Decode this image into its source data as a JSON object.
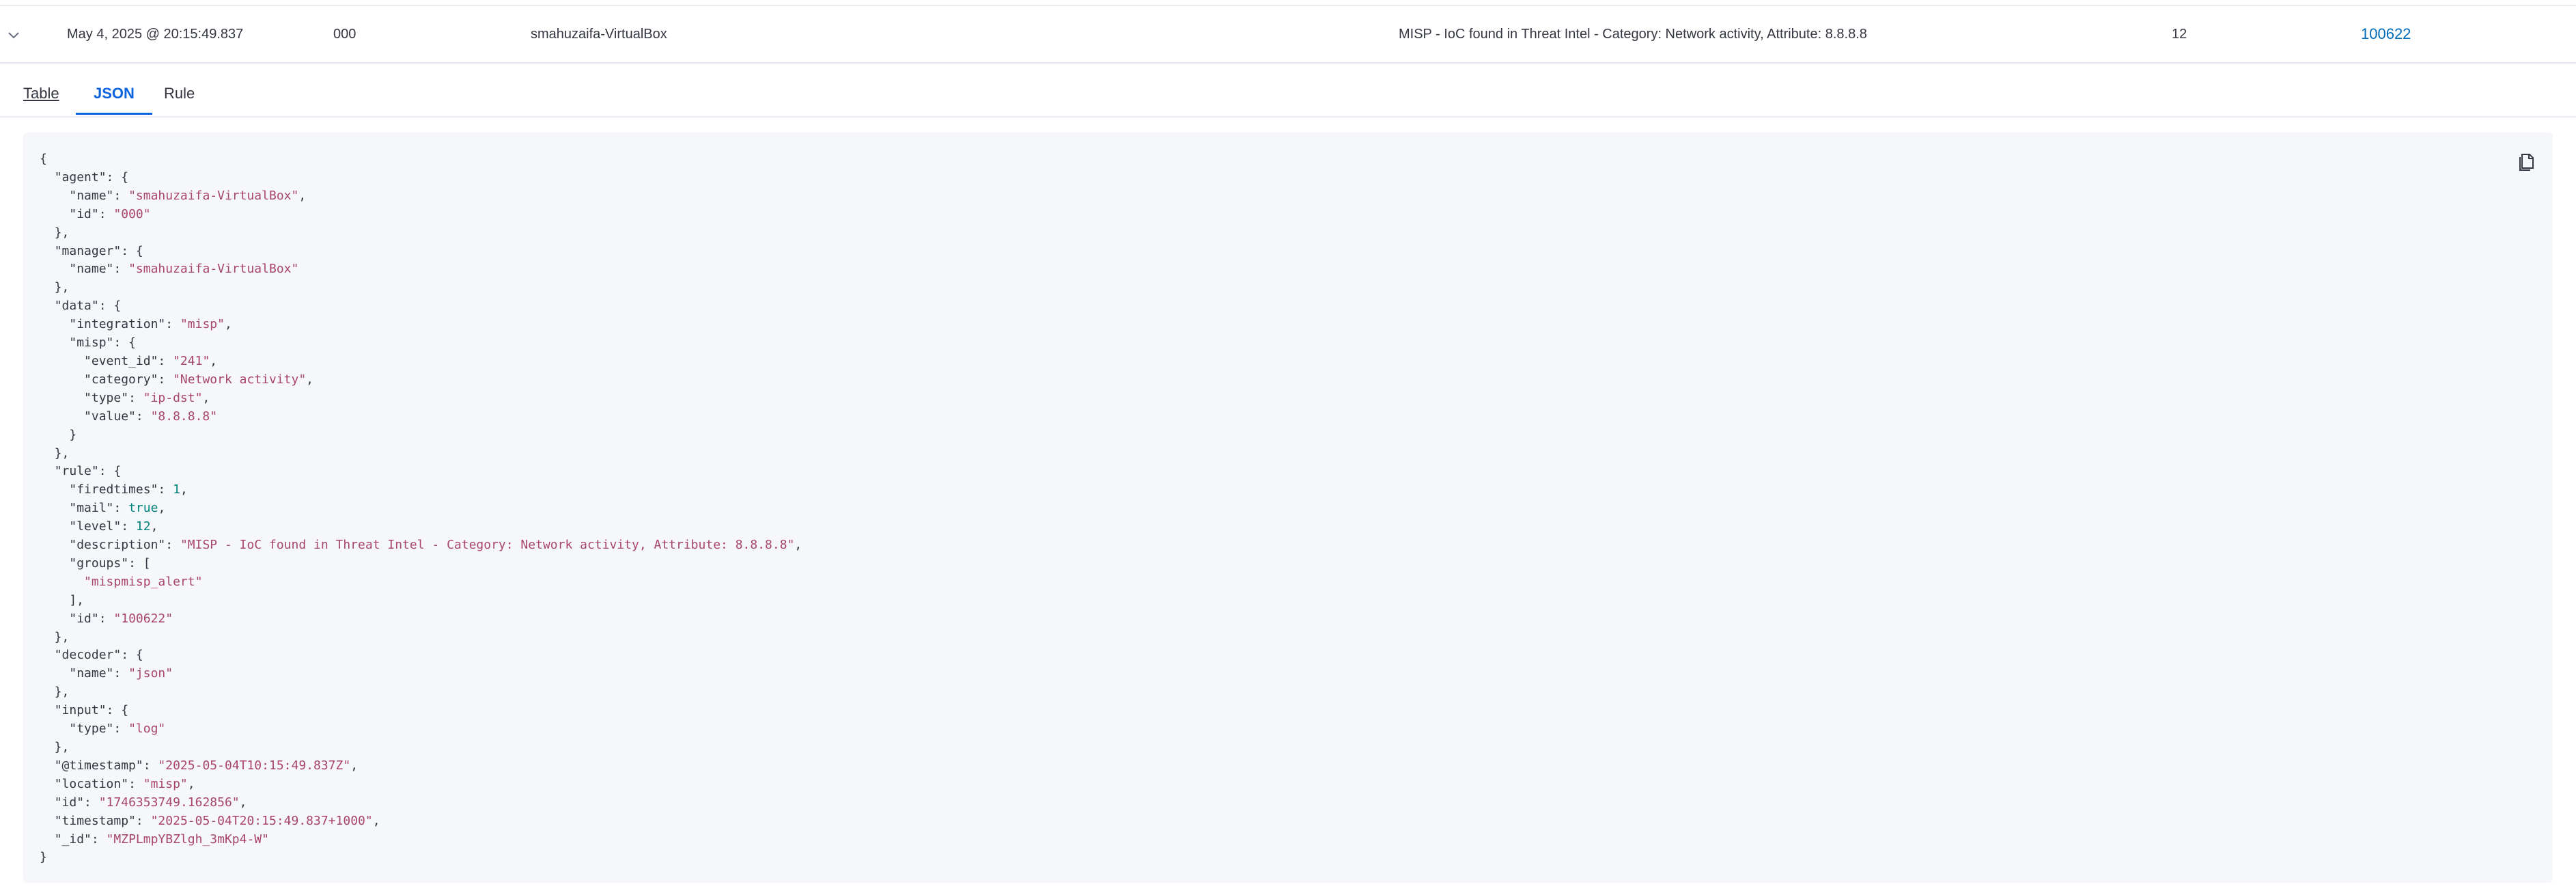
{
  "row": {
    "timestamp": "May 4, 2025 @ 20:15:49.837",
    "agent_id": "000",
    "agent_name": "smahuzaifa-VirtualBox",
    "description": "MISP - IoC found in Threat Intel - Category: Network activity, Attribute: 8.8.8.8",
    "level": "12",
    "rule_id": "100622"
  },
  "tabs": [
    {
      "label": "Table"
    },
    {
      "label": "JSON"
    },
    {
      "label": "Rule"
    }
  ],
  "icons": {
    "expand": "chevron-down-icon",
    "copy": "copy-icon"
  },
  "colors": {
    "accent": "#0b64dd",
    "link": "#006bb8",
    "json_string": "#a8456b",
    "json_number": "#00827a",
    "code_background": "#f5f7fa"
  },
  "json_lines": [
    [
      [
        "p",
        "{"
      ]
    ],
    [
      [
        "p",
        "  "
      ],
      [
        "k",
        "\"agent\""
      ],
      [
        "p",
        ": {"
      ]
    ],
    [
      [
        "p",
        "    "
      ],
      [
        "k",
        "\"name\""
      ],
      [
        "p",
        ": "
      ],
      [
        "s",
        "\"smahuzaifa-VirtualBox\""
      ],
      [
        "p",
        ","
      ]
    ],
    [
      [
        "p",
        "    "
      ],
      [
        "k",
        "\"id\""
      ],
      [
        "p",
        ": "
      ],
      [
        "s",
        "\"000\""
      ]
    ],
    [
      [
        "p",
        "  },"
      ]
    ],
    [
      [
        "p",
        "  "
      ],
      [
        "k",
        "\"manager\""
      ],
      [
        "p",
        ": {"
      ]
    ],
    [
      [
        "p",
        "    "
      ],
      [
        "k",
        "\"name\""
      ],
      [
        "p",
        ": "
      ],
      [
        "s",
        "\"smahuzaifa-VirtualBox\""
      ]
    ],
    [
      [
        "p",
        "  },"
      ]
    ],
    [
      [
        "p",
        "  "
      ],
      [
        "k",
        "\"data\""
      ],
      [
        "p",
        ": {"
      ]
    ],
    [
      [
        "p",
        "    "
      ],
      [
        "k",
        "\"integration\""
      ],
      [
        "p",
        ": "
      ],
      [
        "s",
        "\"misp\""
      ],
      [
        "p",
        ","
      ]
    ],
    [
      [
        "p",
        "    "
      ],
      [
        "k",
        "\"misp\""
      ],
      [
        "p",
        ": {"
      ]
    ],
    [
      [
        "p",
        "      "
      ],
      [
        "k",
        "\"event_id\""
      ],
      [
        "p",
        ": "
      ],
      [
        "s",
        "\"241\""
      ],
      [
        "p",
        ","
      ]
    ],
    [
      [
        "p",
        "      "
      ],
      [
        "k",
        "\"category\""
      ],
      [
        "p",
        ": "
      ],
      [
        "s",
        "\"Network activity\""
      ],
      [
        "p",
        ","
      ]
    ],
    [
      [
        "p",
        "      "
      ],
      [
        "k",
        "\"type\""
      ],
      [
        "p",
        ": "
      ],
      [
        "s",
        "\"ip-dst\""
      ],
      [
        "p",
        ","
      ]
    ],
    [
      [
        "p",
        "      "
      ],
      [
        "k",
        "\"value\""
      ],
      [
        "p",
        ": "
      ],
      [
        "s",
        "\"8.8.8.8\""
      ]
    ],
    [
      [
        "p",
        "    }"
      ]
    ],
    [
      [
        "p",
        "  },"
      ]
    ],
    [
      [
        "p",
        "  "
      ],
      [
        "k",
        "\"rule\""
      ],
      [
        "p",
        ": {"
      ]
    ],
    [
      [
        "p",
        "    "
      ],
      [
        "k",
        "\"firedtimes\""
      ],
      [
        "p",
        ": "
      ],
      [
        "n",
        "1"
      ],
      [
        "p",
        ","
      ]
    ],
    [
      [
        "p",
        "    "
      ],
      [
        "k",
        "\"mail\""
      ],
      [
        "p",
        ": "
      ],
      [
        "n",
        "true"
      ],
      [
        "p",
        ","
      ]
    ],
    [
      [
        "p",
        "    "
      ],
      [
        "k",
        "\"level\""
      ],
      [
        "p",
        ": "
      ],
      [
        "n",
        "12"
      ],
      [
        "p",
        ","
      ]
    ],
    [
      [
        "p",
        "    "
      ],
      [
        "k",
        "\"description\""
      ],
      [
        "p",
        ": "
      ],
      [
        "s",
        "\"MISP - IoC found in Threat Intel - Category: Network activity, Attribute: 8.8.8.8\""
      ],
      [
        "p",
        ","
      ]
    ],
    [
      [
        "p",
        "    "
      ],
      [
        "k",
        "\"groups\""
      ],
      [
        "p",
        ": ["
      ]
    ],
    [
      [
        "p",
        "      "
      ],
      [
        "s",
        "\"mispmisp_alert\""
      ]
    ],
    [
      [
        "p",
        "    ],"
      ]
    ],
    [
      [
        "p",
        "    "
      ],
      [
        "k",
        "\"id\""
      ],
      [
        "p",
        ": "
      ],
      [
        "s",
        "\"100622\""
      ]
    ],
    [
      [
        "p",
        "  },"
      ]
    ],
    [
      [
        "p",
        "  "
      ],
      [
        "k",
        "\"decoder\""
      ],
      [
        "p",
        ": {"
      ]
    ],
    [
      [
        "p",
        "    "
      ],
      [
        "k",
        "\"name\""
      ],
      [
        "p",
        ": "
      ],
      [
        "s",
        "\"json\""
      ]
    ],
    [
      [
        "p",
        "  },"
      ]
    ],
    [
      [
        "p",
        "  "
      ],
      [
        "k",
        "\"input\""
      ],
      [
        "p",
        ": {"
      ]
    ],
    [
      [
        "p",
        "    "
      ],
      [
        "k",
        "\"type\""
      ],
      [
        "p",
        ": "
      ],
      [
        "s",
        "\"log\""
      ]
    ],
    [
      [
        "p",
        "  },"
      ]
    ],
    [
      [
        "p",
        "  "
      ],
      [
        "k",
        "\"@timestamp\""
      ],
      [
        "p",
        ": "
      ],
      [
        "s",
        "\"2025-05-04T10:15:49.837Z\""
      ],
      [
        "p",
        ","
      ]
    ],
    [
      [
        "p",
        "  "
      ],
      [
        "k",
        "\"location\""
      ],
      [
        "p",
        ": "
      ],
      [
        "s",
        "\"misp\""
      ],
      [
        "p",
        ","
      ]
    ],
    [
      [
        "p",
        "  "
      ],
      [
        "k",
        "\"id\""
      ],
      [
        "p",
        ": "
      ],
      [
        "s",
        "\"1746353749.162856\""
      ],
      [
        "p",
        ","
      ]
    ],
    [
      [
        "p",
        "  "
      ],
      [
        "k",
        "\"timestamp\""
      ],
      [
        "p",
        ": "
      ],
      [
        "s",
        "\"2025-05-04T20:15:49.837+1000\""
      ],
      [
        "p",
        ","
      ]
    ],
    [
      [
        "p",
        "  "
      ],
      [
        "k",
        "\"_id\""
      ],
      [
        "p",
        ": "
      ],
      [
        "s",
        "\"MZPLmpYBZlgh_3mKp4-W\""
      ]
    ],
    [
      [
        "p",
        "}"
      ]
    ]
  ]
}
